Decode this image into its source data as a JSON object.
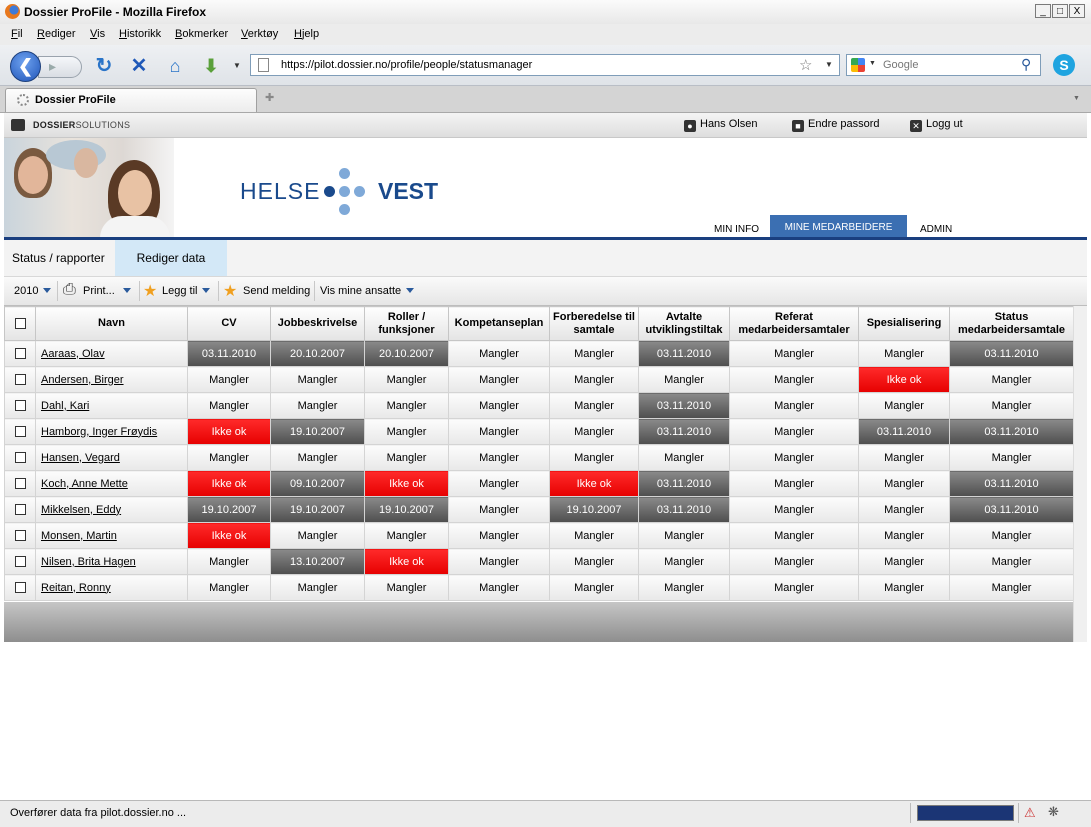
{
  "window": {
    "title": "Dossier ProFile - Mozilla Firefox",
    "buttons": {
      "min": "_",
      "max": "□",
      "close": "X"
    }
  },
  "menu": [
    "Fil",
    "Rediger",
    "Vis",
    "Historikk",
    "Bokmerker",
    "Verktøy",
    "Hjelp"
  ],
  "nav": {
    "url": "https://pilot.dossier.no/profile/people/statusmanager",
    "search_placeholder": "Google"
  },
  "tab": {
    "label": "Dossier ProFile"
  },
  "top": {
    "brand_bold": "DOSSIER",
    "brand_rest": "SOLUTIONS",
    "user": "Hans Olsen",
    "change_password": "Endre passord",
    "logout": "Logg ut"
  },
  "logo": {
    "left": "HELSE",
    "right": "VEST"
  },
  "main_nav": [
    "MIN INFO",
    "MINE MEDARBEIDERE",
    "ADMIN"
  ],
  "main_nav_active": "MINE MEDARBEIDERE",
  "sub_tabs": [
    "Status / rapporter",
    "Rediger data"
  ],
  "toolbar": {
    "year": "2010",
    "print": "Print...",
    "add": "Legg til",
    "send": "Send melding",
    "show": "Vis mine ansatte"
  },
  "table": {
    "headers": [
      "Navn",
      "CV",
      "Jobbeskrivelse",
      "Roller / funksjoner",
      "Kompetanseplan",
      "Forberedelse til samtale",
      "Avtalte utviklingstiltak",
      "Referat medarbeidersamtaler",
      "Spesialisering",
      "Status medarbeidersamtale"
    ],
    "rows": [
      {
        "name": "Aaraas, Olav",
        "cells": [
          "03.11.2010",
          "20.10.2007",
          "20.10.2007",
          "Mangler",
          "Mangler",
          "03.11.2010",
          "Mangler",
          "Mangler",
          "03.11.2010"
        ]
      },
      {
        "name": "Andersen, Birger",
        "cells": [
          "Mangler",
          "Mangler",
          "Mangler",
          "Mangler",
          "Mangler",
          "Mangler",
          "Mangler",
          "Ikke ok",
          "Mangler"
        ]
      },
      {
        "name": "Dahl, Kari",
        "cells": [
          "Mangler",
          "Mangler",
          "Mangler",
          "Mangler",
          "Mangler",
          "03.11.2010",
          "Mangler",
          "Mangler",
          "Mangler"
        ]
      },
      {
        "name": "Hamborg, Inger Frøydis",
        "cells": [
          "Ikke ok",
          "19.10.2007",
          "Mangler",
          "Mangler",
          "Mangler",
          "03.11.2010",
          "Mangler",
          "03.11.2010",
          "03.11.2010"
        ]
      },
      {
        "name": "Hansen, Vegard",
        "cells": [
          "Mangler",
          "Mangler",
          "Mangler",
          "Mangler",
          "Mangler",
          "Mangler",
          "Mangler",
          "Mangler",
          "Mangler"
        ]
      },
      {
        "name": "Koch, Anne Mette",
        "cells": [
          "Ikke ok",
          "09.10.2007",
          "Ikke ok",
          "Mangler",
          "Ikke ok",
          "03.11.2010",
          "Mangler",
          "Mangler",
          "03.11.2010"
        ]
      },
      {
        "name": "Mikkelsen, Eddy",
        "cells": [
          "19.10.2007",
          "19.10.2007",
          "19.10.2007",
          "Mangler",
          "19.10.2007",
          "03.11.2010",
          "Mangler",
          "Mangler",
          "03.11.2010"
        ]
      },
      {
        "name": "Monsen, Martin",
        "cells": [
          "Ikke ok",
          "Mangler",
          "Mangler",
          "Mangler",
          "Mangler",
          "Mangler",
          "Mangler",
          "Mangler",
          "Mangler"
        ]
      },
      {
        "name": "Nilsen, Brita Hagen",
        "cells": [
          "Mangler",
          "13.10.2007",
          "Ikke ok",
          "Mangler",
          "Mangler",
          "Mangler",
          "Mangler",
          "Mangler",
          "Mangler"
        ]
      },
      {
        "name": "Reitan, Ronny",
        "cells": [
          "Mangler",
          "Mangler",
          "Mangler",
          "Mangler",
          "Mangler",
          "Mangler",
          "Mangler",
          "Mangler",
          "Mangler"
        ]
      }
    ]
  },
  "colors": {
    "ok": "#555555",
    "not_ok": "#ff0000",
    "missing": "#eeeeee",
    "accent": "#1a3f7f"
  },
  "status": {
    "text": "Overfører data fra pilot.dossier.no ..."
  }
}
